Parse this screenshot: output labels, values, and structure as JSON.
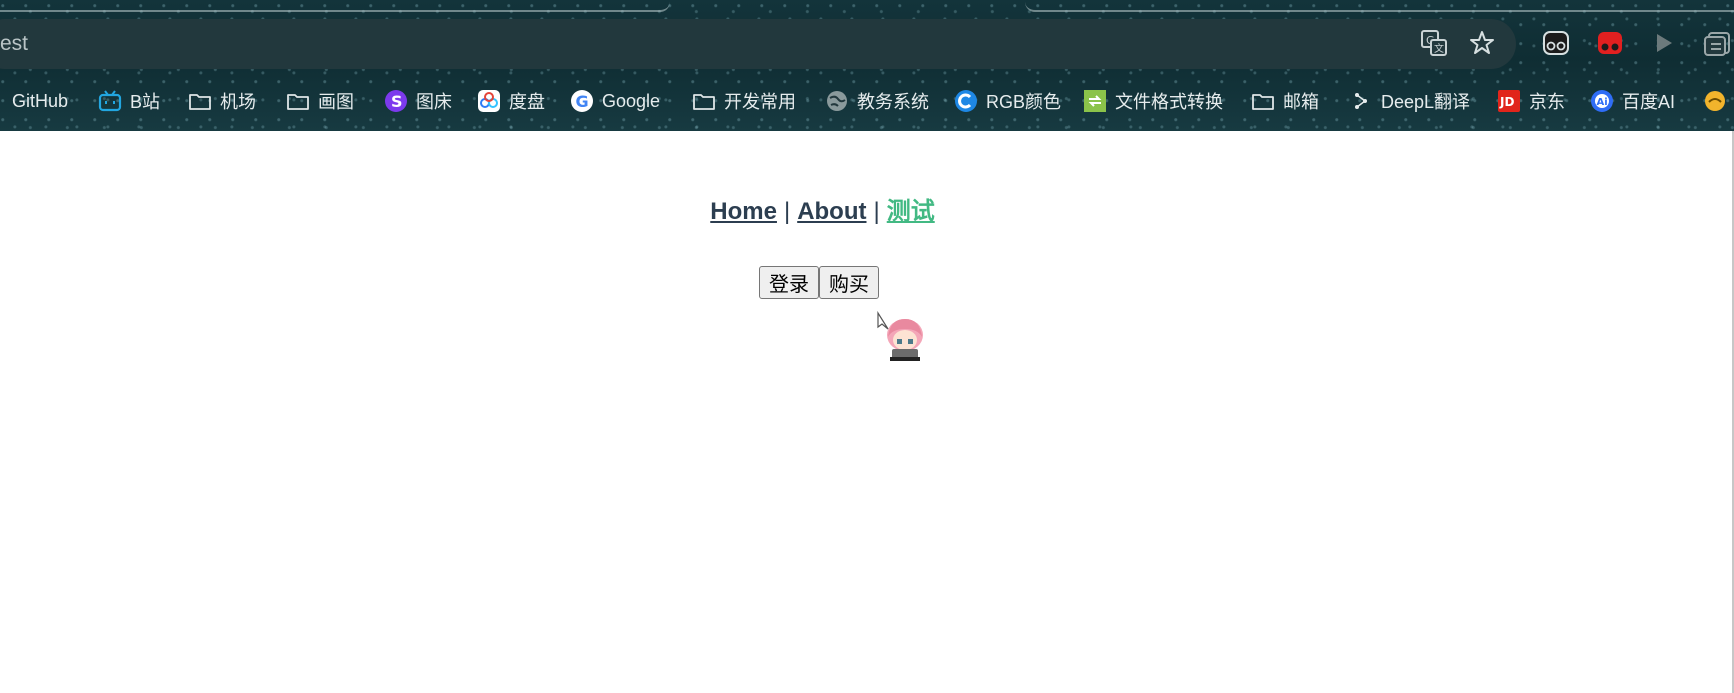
{
  "browser": {
    "address_text": "est",
    "toolbar_icons": [
      "translate-icon",
      "star-icon",
      "extension-glasses-icon",
      "extension-red-icon",
      "play-icon",
      "reading-list-icon"
    ],
    "bookmarks": [
      {
        "label": "GitHub",
        "icon": "none"
      },
      {
        "label": "B站",
        "icon": "bilibili-icon",
        "color": "#22a6e0"
      },
      {
        "label": "机场",
        "icon": "folder-icon"
      },
      {
        "label": "画图",
        "icon": "folder-icon"
      },
      {
        "label": "图床",
        "icon": "s-logo-icon",
        "color": "#7c3aed"
      },
      {
        "label": "度盘",
        "icon": "baidu-pan-icon",
        "color": "#2f7cf6"
      },
      {
        "label": "Google",
        "icon": "google-icon"
      },
      {
        "label": "开发常用",
        "icon": "folder-icon"
      },
      {
        "label": "教务系统",
        "icon": "globe-icon"
      },
      {
        "label": "RGB颜色",
        "icon": "c-logo-icon",
        "color": "#1e88e5"
      },
      {
        "label": "文件格式转换",
        "icon": "convert-icon",
        "color": "#8bc34a"
      },
      {
        "label": "邮箱",
        "icon": "folder-icon"
      },
      {
        "label": "DeepL翻译",
        "icon": "deepl-icon"
      },
      {
        "label": "京东",
        "icon": "jd-icon",
        "color": "#e1251b"
      },
      {
        "label": "百度AI",
        "icon": "baidu-ai-icon",
        "color": "#2f6df6"
      }
    ]
  },
  "page": {
    "nav": {
      "home": "Home",
      "separator": "|",
      "about": "About",
      "test": "测试"
    },
    "buttons": {
      "login": "登录",
      "buy": "购买"
    },
    "colors": {
      "link": "#2c3e50",
      "active_link": "#42b983"
    }
  }
}
